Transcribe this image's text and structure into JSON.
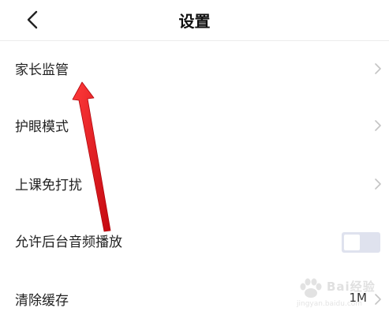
{
  "header": {
    "title": "设置"
  },
  "settings": {
    "items": [
      {
        "label": "家长监管"
      },
      {
        "label": "护眼模式"
      },
      {
        "label": "上课免打扰"
      },
      {
        "label": "允许后台音频播放"
      },
      {
        "label": "清除缓存",
        "value": "1M"
      }
    ],
    "background_audio_enabled": false
  },
  "watermark": {
    "text": "Bai经验",
    "url": "jingyan.baidu.com"
  },
  "colors": {
    "annotation_arrow": "#e8121c",
    "toggle_off": "#dfe2ee",
    "divider": "#ececec"
  }
}
